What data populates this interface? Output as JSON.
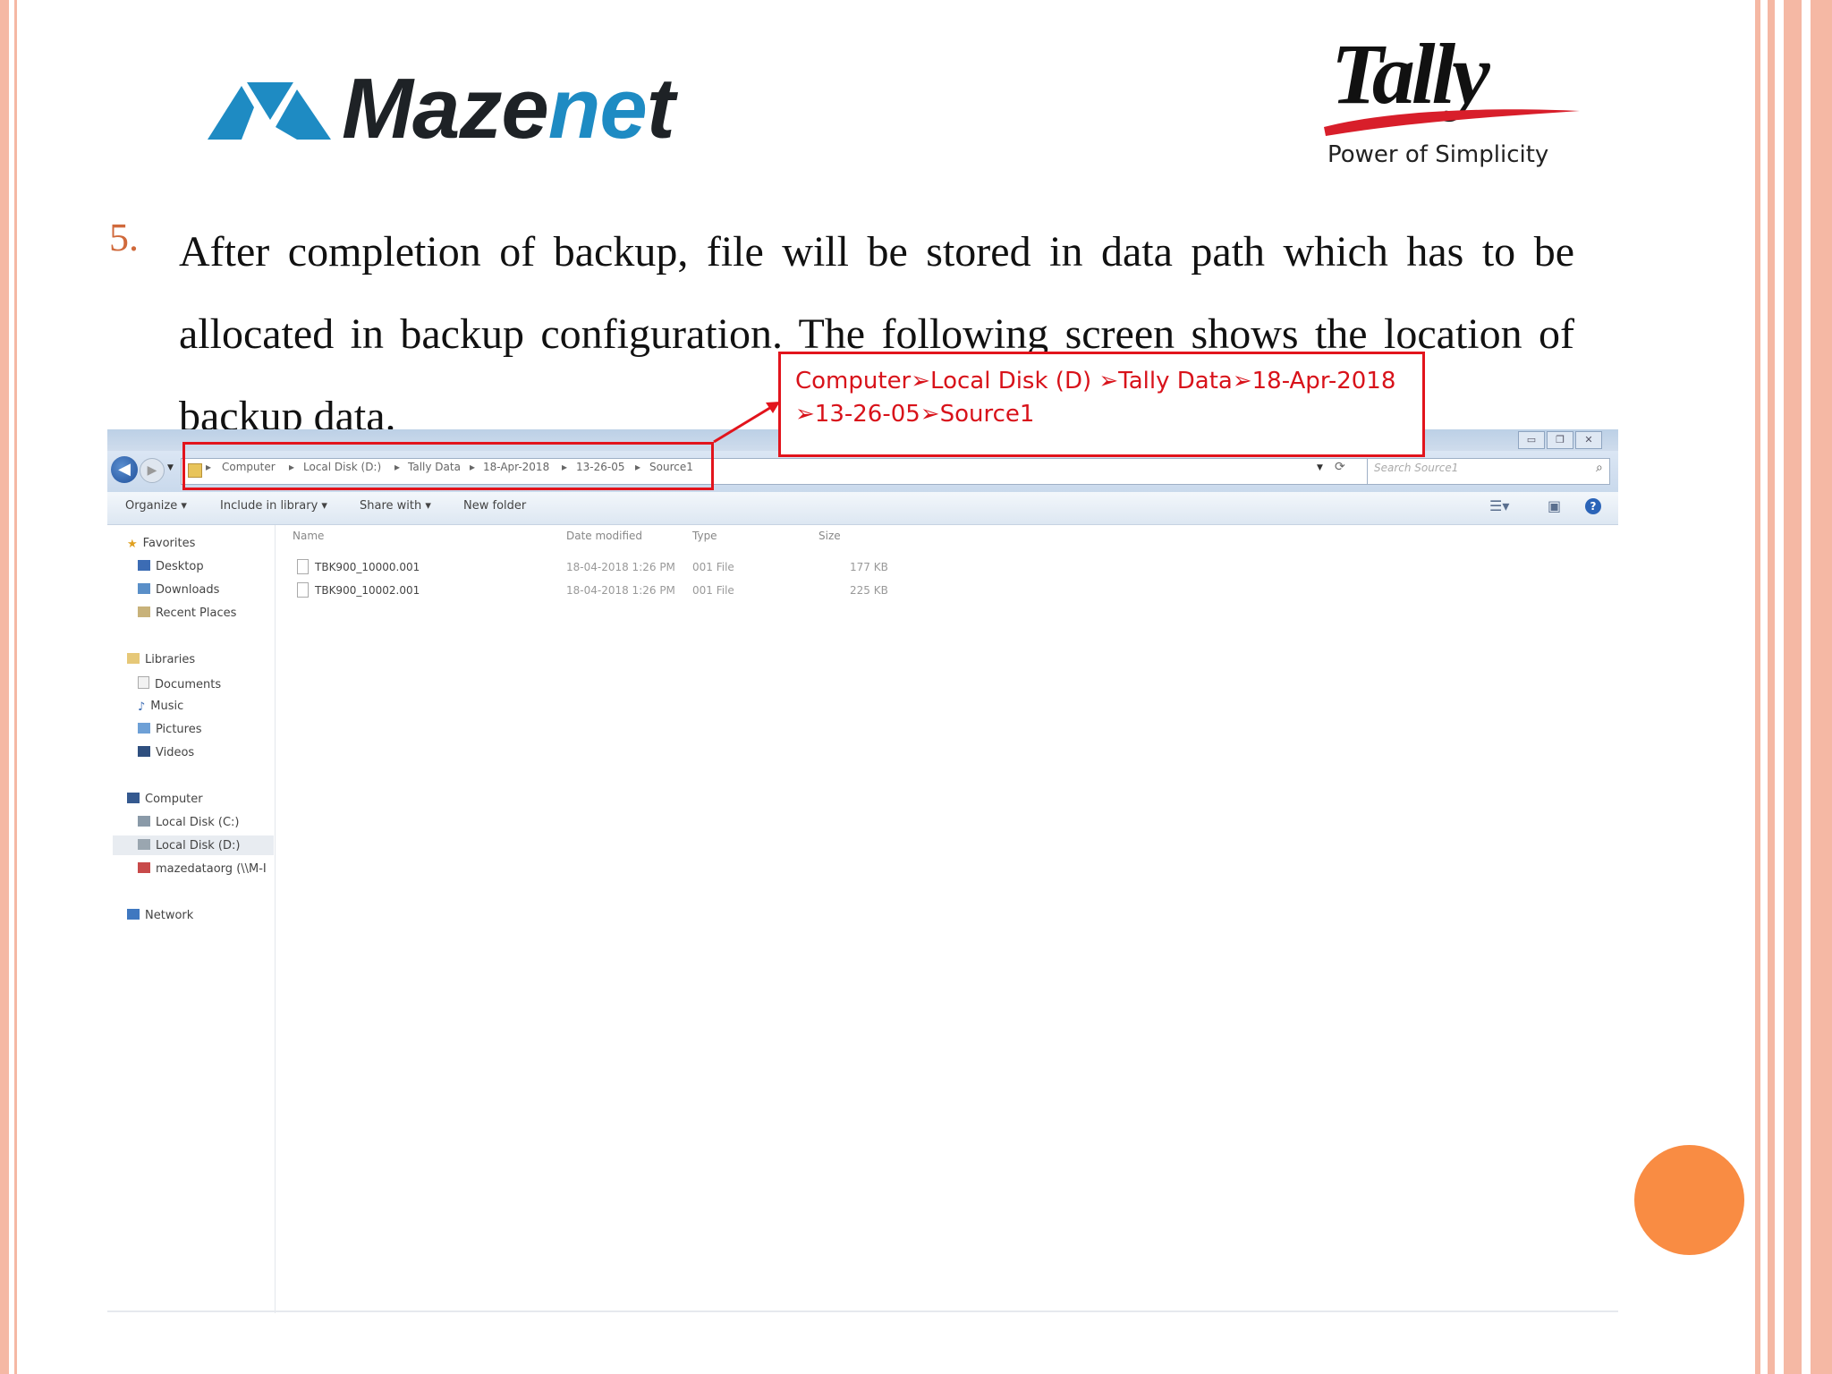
{
  "logos": {
    "mazenet": {
      "prefix": "Maze",
      "highlight": "ne",
      "suffix": "t"
    },
    "tally": {
      "word": "Tally",
      "tagline": "Power of Simplicity"
    }
  },
  "step": {
    "number": "5.",
    "text": "After completion of backup, file will be stored in data path which has to be allocated in backup configuration. The following screen shows the location of backup data."
  },
  "callout": {
    "line1": "Computer➢Local Disk (D) ➢Tally Data➢18-Apr-2018",
    "line2": "➢13-26-05➢Source1"
  },
  "explorer": {
    "breadcrumb": [
      "Computer",
      "Local Disk (D:)",
      "Tally Data",
      "18-Apr-2018",
      "13-26-05",
      "Source1"
    ],
    "search_placeholder": "Search Source1",
    "toolbar": {
      "organize": "Organize ▾",
      "include_in_library": "Include in library ▾",
      "share_with": "Share with ▾",
      "new_folder": "New folder"
    },
    "nav": {
      "favorites": "Favorites",
      "desktop": "Desktop",
      "downloads": "Downloads",
      "recent_places": "Recent Places",
      "libraries": "Libraries",
      "documents": "Documents",
      "music": "Music",
      "pictures": "Pictures",
      "videos": "Videos",
      "computer": "Computer",
      "local_disk_c": "Local Disk (C:)",
      "local_disk_d": "Local Disk (D:)",
      "network_share": "mazedataorg (\\\\M-I",
      "network": "Network"
    },
    "columns": {
      "name": "Name",
      "date_modified": "Date modified",
      "type": "Type",
      "size": "Size"
    },
    "files": [
      {
        "name": "TBK900_10000.001",
        "date": "18-04-2018 1:26 PM",
        "type": "001 File",
        "size": "177 KB"
      },
      {
        "name": "TBK900_10002.001",
        "date": "18-04-2018 1:26 PM",
        "type": "001 File",
        "size": "225 KB"
      }
    ]
  },
  "colors": {
    "accent_orange": "#f98c43",
    "border_peach": "#f5b8a4",
    "callout_red": "#e2141c",
    "step_number": "#d0693b"
  }
}
